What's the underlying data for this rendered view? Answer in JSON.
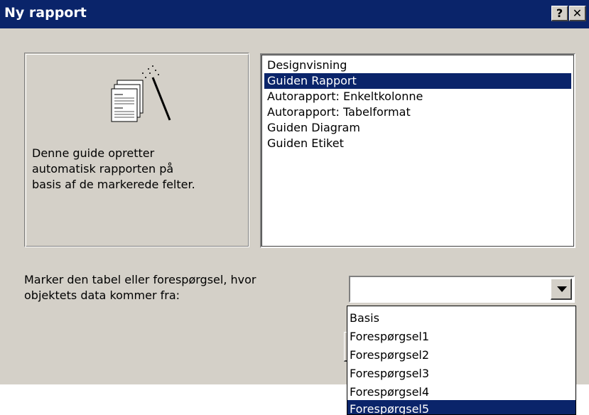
{
  "window": {
    "title": "Ny rapport",
    "help_label": "?",
    "close_label": "✕"
  },
  "preview": {
    "icon": "report-wizard-icon",
    "description_lines": [
      "Denne guide opretter",
      "automatisk rapporten på",
      "basis af de markerede felter."
    ]
  },
  "report_types": {
    "items": [
      "Designvisning",
      "Guiden Rapport",
      "Autorapport: Enkeltkolonne",
      "Autorapport: Tabelformat",
      "Guiden Diagram",
      "Guiden Etiket"
    ],
    "selected_index": 1
  },
  "source": {
    "prompt_lines": [
      "Marker den tabel eller forespørgsel, hvor",
      "objektets data kommer fra:"
    ],
    "value": "",
    "options": [
      "Basis",
      "Forespørgsel1",
      "Forespørgsel2",
      "Forespørgsel3",
      "Forespørgsel4",
      "Forespørgsel5"
    ],
    "highlighted_index": 5
  },
  "colors": {
    "face": "#d4d0c8",
    "title_bar": "#0a246a",
    "selection": "#0a246a"
  }
}
